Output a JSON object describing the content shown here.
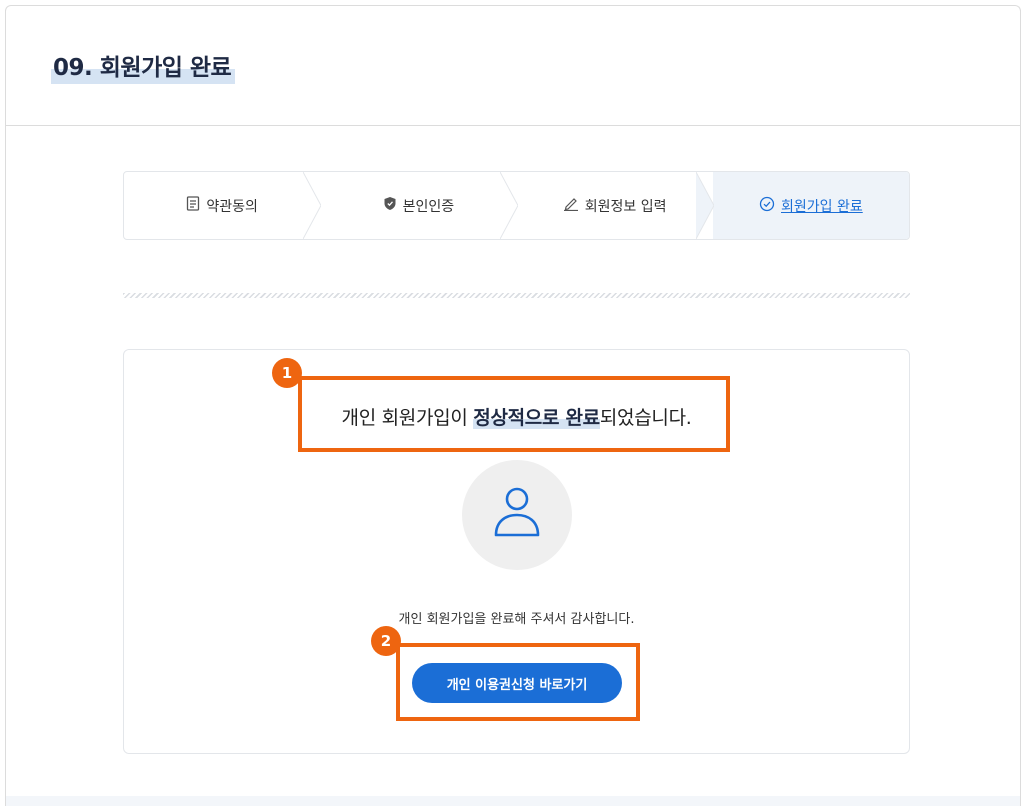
{
  "page": {
    "title": "09. 회원가입 완료"
  },
  "stepper": {
    "steps": [
      {
        "label": "약관동의",
        "icon": "document-icon"
      },
      {
        "label": "본인인증",
        "icon": "shield-icon"
      },
      {
        "label": "회원정보 입력",
        "icon": "pencil-icon"
      },
      {
        "label": "회원가입 완료",
        "icon": "check-circle-icon",
        "active": true
      }
    ]
  },
  "completion": {
    "message_prefix": "개인 회원가입이 ",
    "message_emphasis": "정상적으로 완료",
    "message_suffix": "되었습니다.",
    "avatar_icon": "user-icon",
    "thanks": "개인 회원가입을 완료해 주셔서 감사합니다.",
    "cta_label": "개인 이용권신청 바로가기"
  },
  "annotations": [
    {
      "number": "1",
      "target": "completion-message"
    },
    {
      "number": "2",
      "target": "cta-button"
    }
  ],
  "colors": {
    "accent": "#1b6ed6",
    "annotation": "#ee6510",
    "highlight": "#d5e3f3",
    "active_step_bg": "#eef3f9"
  }
}
